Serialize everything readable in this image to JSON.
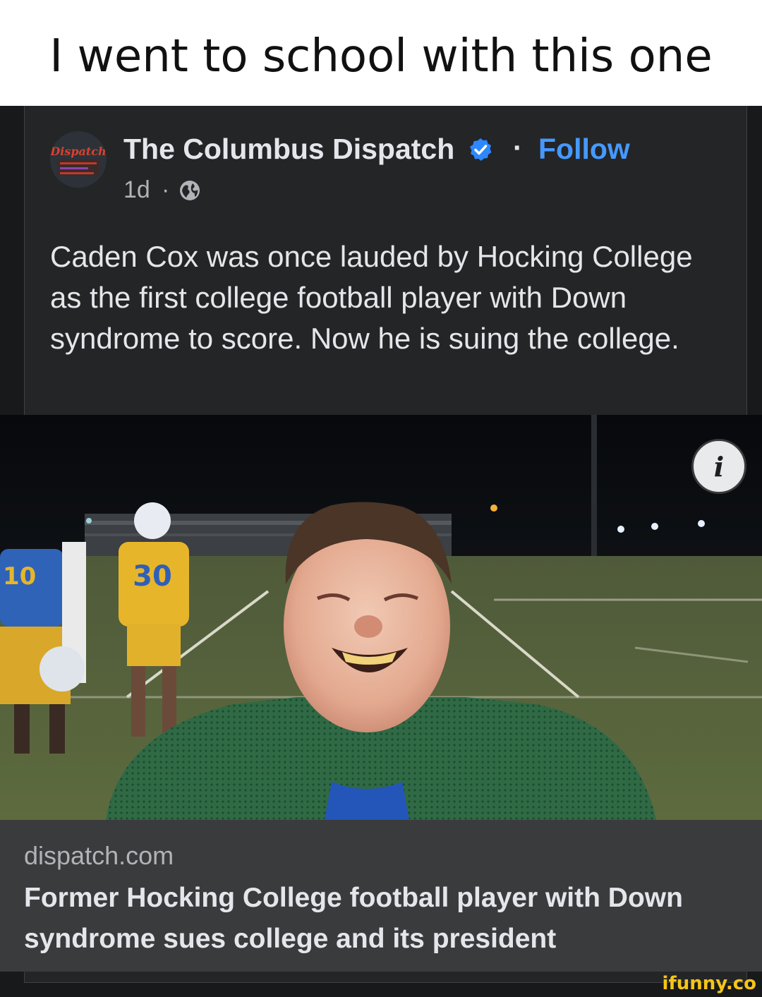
{
  "caption": "I went to school with this one",
  "post": {
    "page_name": "The Columbus Dispatch",
    "separator": "·",
    "follow_label": "Follow",
    "time": "1d",
    "time_separator": "·",
    "avatar_text": "Dispatch",
    "text": "Caden Cox was once lauded by Hocking College as the first college football player with Down syndrome to score. Now he is suing the college.",
    "photo": {
      "jersey_number": "30",
      "jersey_number_left": "10"
    },
    "link": {
      "domain": "dispatch.com",
      "title": "Former Hocking College football player with Down syndrome sues college and its president"
    }
  },
  "watermark": "ifunny.co",
  "icons": {
    "verified": "verified-badge-icon",
    "globe": "globe-icon",
    "info": "info-icon"
  },
  "colors": {
    "background": "#18191a",
    "card": "#242526",
    "link_card": "#3a3b3c",
    "accent": "#4599ff",
    "verified": "#2d88ff"
  }
}
